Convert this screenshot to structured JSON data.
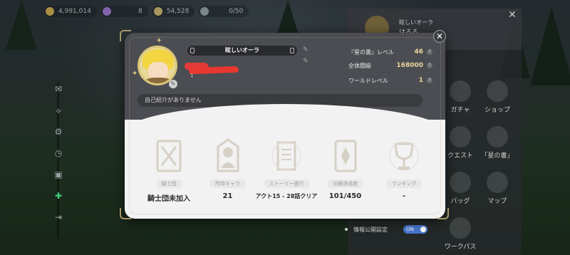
{
  "topbar": {
    "resources": [
      {
        "icon": "coin-icon",
        "value": "4,991,014",
        "color": "#e0b84a"
      },
      {
        "icon": "gem-icon",
        "value": "8",
        "color": "#a878e0"
      },
      {
        "icon": "stamina-icon",
        "value": "54,528",
        "color": "#e0c070"
      },
      {
        "icon": "sword-icon",
        "value": "0/50",
        "color": "#9aa"
      }
    ]
  },
  "right_panel": {
    "title": "眩しいオーラ",
    "name": "はるる",
    "items": [
      {
        "label": "ガチャ"
      },
      {
        "label": "ショップ"
      },
      {
        "label": "クエスト"
      },
      {
        "label": "「星の書」"
      },
      {
        "label": "バッグ"
      },
      {
        "label": "マップ"
      },
      {
        "label": "ワークパス"
      }
    ]
  },
  "info_toggle": {
    "label": "情報公開設定",
    "state": "ON"
  },
  "profile": {
    "title": "眩しいオーラ",
    "id_prefix": "1",
    "intro": "自己紹介がありません",
    "stats_right": [
      {
        "label": "『星の書』レベル",
        "value": "46"
      },
      {
        "label": "全体闘級",
        "value": "168000"
      },
      {
        "label": "ワールドレベル",
        "value": "1"
      }
    ],
    "achievements": [
      {
        "label": "騎士団",
        "value": "騎士団未加入",
        "icon": "knight-banner-icon"
      },
      {
        "label": "所持キャラ",
        "value": "21",
        "icon": "character-silhouette-icon"
      },
      {
        "label": "ストーリー進行",
        "value": "アクト15 - 28話クリア",
        "icon": "scroll-icon"
      },
      {
        "label": "功績達成度",
        "value": "101/450",
        "icon": "book-icon"
      },
      {
        "label": "ランキング",
        "value": "-",
        "icon": "trophy-icon"
      }
    ]
  },
  "colors": {
    "accent_gold": "#e9d59a",
    "toggle_blue": "#4a78d2",
    "name_redaction": "#e23a3a"
  }
}
